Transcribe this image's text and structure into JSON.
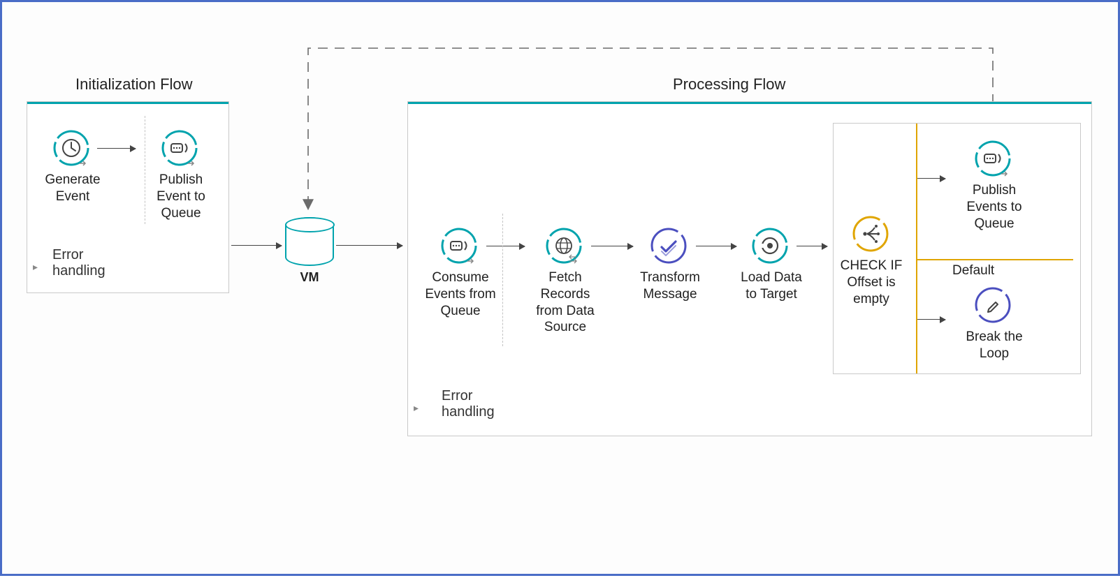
{
  "init_flow": {
    "title": "Initialization Flow",
    "nodes": {
      "generate_event": "Generate\nEvent",
      "publish_event": "Publish\nEvent to\nQueue"
    },
    "error_section": "Error\nhandling"
  },
  "vm_label": "VM",
  "proc_flow": {
    "title": "Processing Flow",
    "nodes": {
      "consume": "Consume\nEvents from\nQueue",
      "fetch": "Fetch\nRecords\nfrom Data\nSource",
      "transform": "Transform\nMessage",
      "load": "Load Data\nto Target",
      "check": "CHECK IF\nOffset is\nempty",
      "publish": "Publish\nEvents to\nQueue",
      "default_label": "Default",
      "break_loop": "Break the\nLoop"
    },
    "error_section": "Error\nhandling"
  },
  "icons": {
    "scheduler": "scheduler-icon",
    "vm_publish": "vm-publish-icon",
    "vm_consume": "vm-consume-icon",
    "http": "http-globe-icon",
    "transform": "transform-icon",
    "db_load": "db-load-icon",
    "choice": "choice-router-icon",
    "logger": "logger-icon",
    "vm": "vm-cylinder-icon"
  },
  "colors": {
    "teal": "#00a3ad",
    "indigo": "#4b4fbf",
    "gold": "#e0a500",
    "border_blue": "#4a6dc7",
    "gray_arrow": "#444444",
    "dashed_gray": "#6b6b6b",
    "panel_border": "#c9c9c9"
  }
}
